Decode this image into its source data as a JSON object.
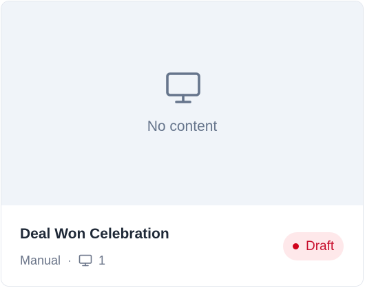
{
  "card": {
    "preview": {
      "icon": "monitor-icon",
      "empty_text": "No content"
    },
    "title": "Deal Won Celebration",
    "meta": {
      "source": "Manual",
      "separator": "·",
      "screen_icon": "monitor-icon",
      "screen_count": "1"
    },
    "status": {
      "label": "Draft",
      "color": "#c8102e",
      "background": "#fee8ea"
    }
  }
}
